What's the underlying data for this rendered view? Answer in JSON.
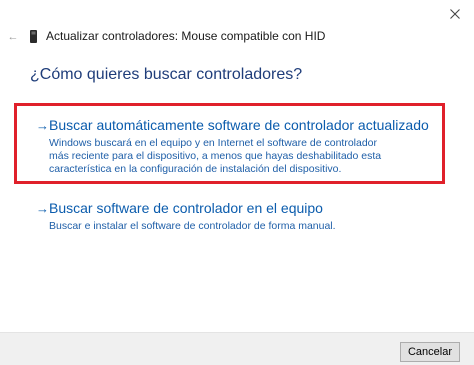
{
  "window": {
    "title": "Actualizar controladores: Mouse compatible con HID",
    "close_icon": "close-icon",
    "back_icon": "back-arrow-icon",
    "device_icon": "mouse-device-icon"
  },
  "main": {
    "question": "¿Cómo quieres buscar controladores?",
    "options": [
      {
        "title": "Buscar automáticamente software de controlador actualizado",
        "description": "Windows buscará en el equipo y en Internet el software de controlador más reciente para el dispositivo, a menos que hayas deshabilitado esta característica en la configuración de instalación del dispositivo.",
        "highlighted": true
      },
      {
        "title": "Buscar software de controlador en el equipo",
        "description": "Buscar e instalar el software de controlador de forma manual.",
        "highlighted": false
      }
    ],
    "arrow_glyph": "→"
  },
  "footer": {
    "cancel_label": "Cancelar"
  },
  "colors": {
    "highlight_border": "#e0202a",
    "link": "#0b5cad",
    "heading": "#1f3d7a"
  }
}
